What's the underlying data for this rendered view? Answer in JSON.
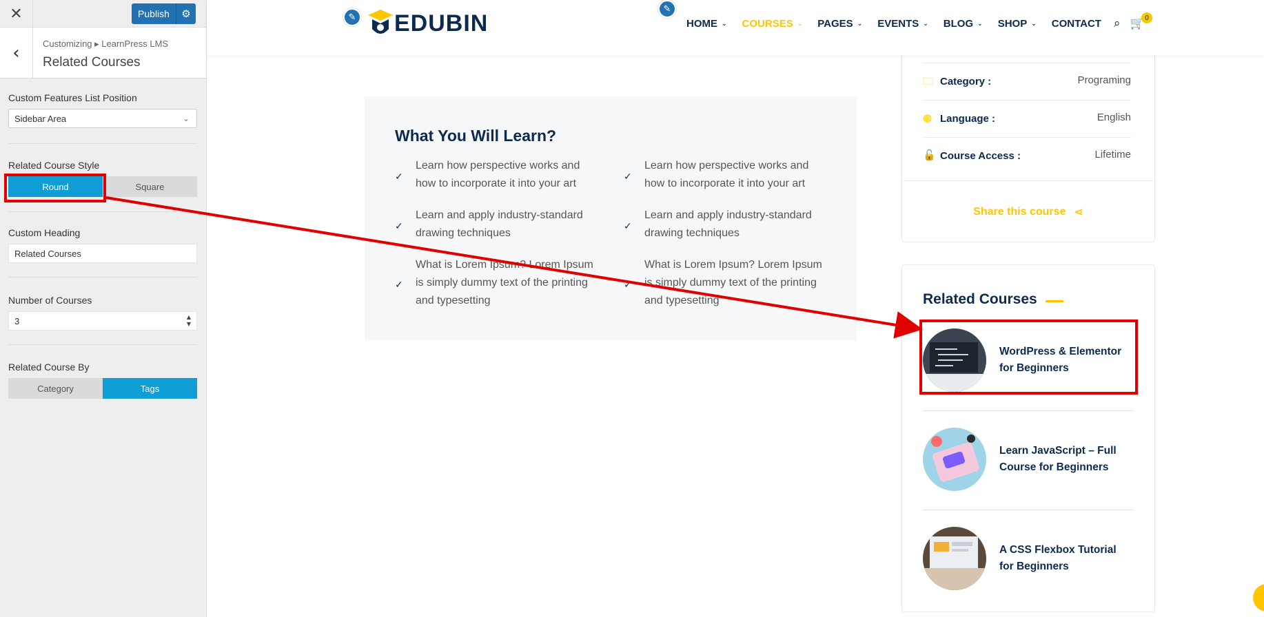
{
  "customizer": {
    "publish_label": "Publish",
    "breadcrumb": "Customizing ▸ LearnPress LMS",
    "section_title": "Related Courses",
    "features_position": {
      "label": "Custom Features List Position",
      "value": "Sidebar Area"
    },
    "course_style": {
      "label": "Related Course Style",
      "options": [
        "Round",
        "Square"
      ],
      "selected": "Round"
    },
    "custom_heading": {
      "label": "Custom Heading",
      "value": "Related Courses"
    },
    "number_of_courses": {
      "label": "Number of Courses",
      "value": "3"
    },
    "related_by": {
      "label": "Related Course By",
      "options": [
        "Category",
        "Tags"
      ],
      "selected": "Tags"
    }
  },
  "site": {
    "logo_text": "EDUBIN",
    "nav": [
      "HOME",
      "COURSES",
      "PAGES",
      "EVENTS",
      "BLOG",
      "SHOP",
      "CONTACT"
    ],
    "active_nav": "COURSES",
    "cart_count": "0",
    "learn": {
      "heading": "What You Will Learn?",
      "items": [
        "Learn how perspective works and how to incorporate it into your art",
        "Learn how perspective works and how to incorporate it into your art",
        "Learn and apply industry-standard drawing techniques",
        "Learn and apply industry-standard drawing techniques",
        "What is Lorem Ipsum? Lorem Ipsum is simply dummy text of the printing and typesetting",
        "What is Lorem Ipsum? Lorem Ipsum is simply dummy text of the printing and typesetting"
      ]
    },
    "info": [
      {
        "icon": "folder-icon",
        "key": "Category :",
        "value": "Programing"
      },
      {
        "icon": "globe-icon",
        "key": "Language :",
        "value": "English"
      },
      {
        "icon": "lock-icon",
        "key": "Course Access :",
        "value": "Lifetime"
      }
    ],
    "share_label": "Share this course",
    "related": {
      "heading": "Related Courses",
      "courses": [
        "WordPress & Elementor for Beginners",
        "Learn JavaScript – Full Course for Beginners",
        "A CSS Flexbox Tutorial for Beginners"
      ]
    }
  },
  "colors": {
    "accent": "#ffc600",
    "navy": "#0b2a4e",
    "toggle_on": "#0e9dd4",
    "publish": "#2271b1",
    "annotation": "#e00000"
  }
}
